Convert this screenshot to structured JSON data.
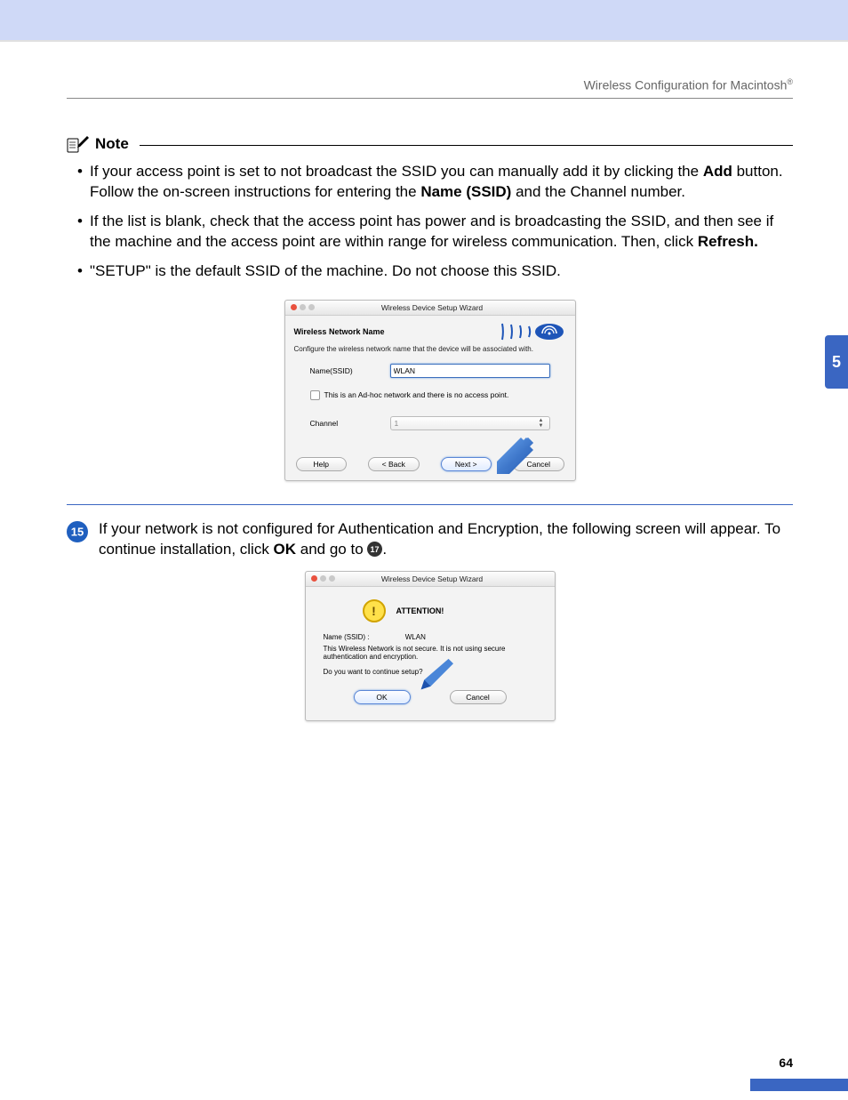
{
  "header": {
    "title_prefix": "Wireless Configuration for Macintosh",
    "registered": "®"
  },
  "chapter_tab": "5",
  "note": {
    "label": "Note",
    "items": {
      "b1a": "If your access point is set to not broadcast the SSID you can manually add it by clicking the ",
      "b1_add": "Add",
      "b1b": " button. Follow the on-screen instructions for entering the ",
      "b1_name": "Name (SSID)",
      "b1c": " and the Channel number.",
      "b2a": "If the list is blank, check that the access point has power and is broadcasting the SSID, and then see if the machine and the access point are within range for wireless communication. Then, click ",
      "b2_refresh": "Refresh.",
      "b3": "\"SETUP\" is the default SSID of the machine. Do not choose this SSID."
    }
  },
  "dialog1": {
    "title": "Wireless Device Setup Wizard",
    "heading": "Wireless Network Name",
    "desc": "Configure the wireless network name that the device will be associated with.",
    "name_label": "Name(SSID)",
    "name_value": "WLAN",
    "adhoc_label": "This is an Ad-hoc network and there is no access point.",
    "channel_label": "Channel",
    "channel_value": "1",
    "btn_help": "Help",
    "btn_back": "< Back",
    "btn_next": "Next >",
    "btn_cancel": "Cancel"
  },
  "step15": {
    "number": "15",
    "text_a": "If your network is not configured for Authentication and Encryption, the following screen will appear. To continue installation, click ",
    "ok": "OK",
    "text_b": " and go to ",
    "goto": "17",
    "text_c": "."
  },
  "dialog2": {
    "title": "Wireless Device Setup Wizard",
    "attention": "ATTENTION!",
    "ssid_label": "Name (SSID) :",
    "ssid_value": "WLAN",
    "warn": "This Wireless Network is not secure. It is not using secure authentication and encryption.",
    "question": "Do you want to continue setup?",
    "btn_ok": "OK",
    "btn_cancel": "Cancel"
  },
  "page_number": "64"
}
